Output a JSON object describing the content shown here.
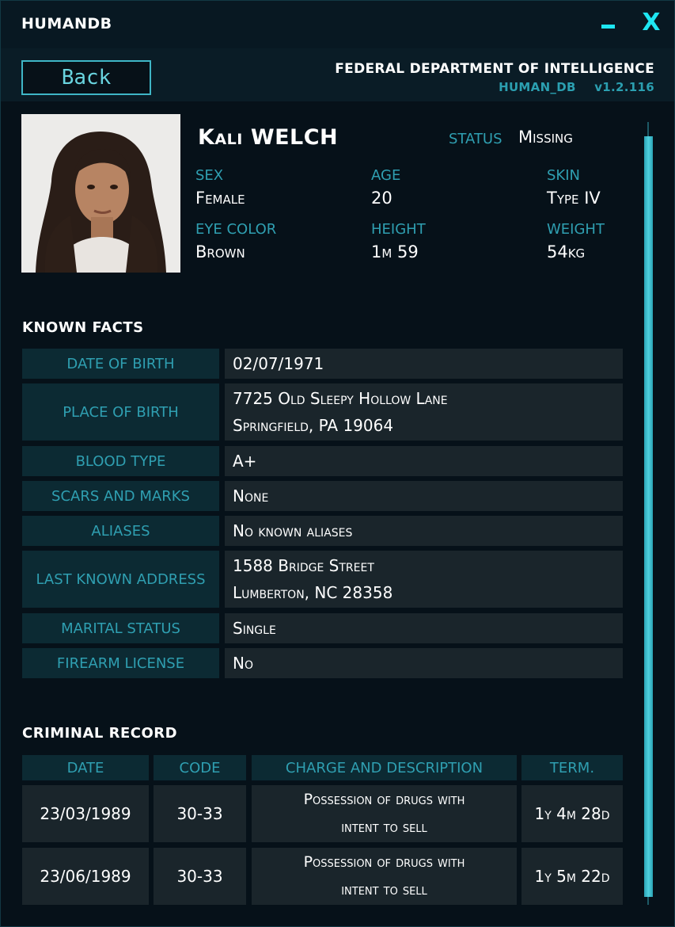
{
  "window": {
    "title": "HUMANDB",
    "minimize_label": "−",
    "close_label": "X"
  },
  "header": {
    "back_label": "Back",
    "agency": "FEDERAL DEPARTMENT OF INTELLIGENCE",
    "db_name": "HUMAN_DB",
    "version": "v1.2.116"
  },
  "profile": {
    "first_name": "Kali",
    "last_name": "WELCH",
    "status_label": "STATUS",
    "status_value": "Missing",
    "fields": [
      {
        "label": "SEX",
        "value": "Female"
      },
      {
        "label": "AGE",
        "value": "20"
      },
      {
        "label": "SKIN",
        "value": "Type IV"
      },
      {
        "label": "EYE COLOR",
        "value": "Brown"
      },
      {
        "label": "HEIGHT",
        "value": "1m 59"
      },
      {
        "label": "WEIGHT",
        "value": "54kg"
      }
    ]
  },
  "known_facts": {
    "title": "KNOWN  FACTS",
    "rows": [
      {
        "label": "DATE OF BIRTH",
        "lines": [
          "02/07/1971"
        ]
      },
      {
        "label": "PLACE OF BIRTH",
        "lines": [
          "7725 Old Sleepy Hollow Lane",
          "Springfield, PA 19064"
        ]
      },
      {
        "label": "BLOOD TYPE",
        "lines": [
          "A+"
        ]
      },
      {
        "label": "SCARS AND MARKS",
        "lines": [
          "None"
        ]
      },
      {
        "label": "ALIASES",
        "lines": [
          "No known aliases"
        ]
      },
      {
        "label": "LAST KNOWN ADDRESS",
        "lines": [
          "1588 Bridge Street",
          "Lumberton, NC 28358"
        ]
      },
      {
        "label": "MARITAL STATUS",
        "lines": [
          "Single"
        ]
      },
      {
        "label": "FIREARM LICENSE",
        "lines": [
          "No"
        ]
      }
    ]
  },
  "criminal_record": {
    "title": "CRIMINAL  RECORD",
    "headers": [
      "DATE",
      "CODE",
      "CHARGE AND DESCRIPTION",
      "TERM."
    ],
    "rows": [
      {
        "date": "23/03/1989",
        "code": "30-33",
        "desc1": "Possession of drugs with",
        "desc2": "intent to sell",
        "term": "1y 4m 28d"
      },
      {
        "date": "23/06/1989",
        "code": "30-33",
        "desc1": "Possession of drugs with",
        "desc2": "intent to sell",
        "term": "1y 5m 22d"
      }
    ]
  },
  "colors": {
    "accent": "#1ee6f2",
    "label": "#2f9fb1",
    "label_bg": "#0c2a33",
    "value_bg": "#1a252b",
    "background": "#061119"
  },
  "icons": {
    "minimize": "minimize-icon",
    "close": "close-icon",
    "portrait": "portrait-photo"
  }
}
